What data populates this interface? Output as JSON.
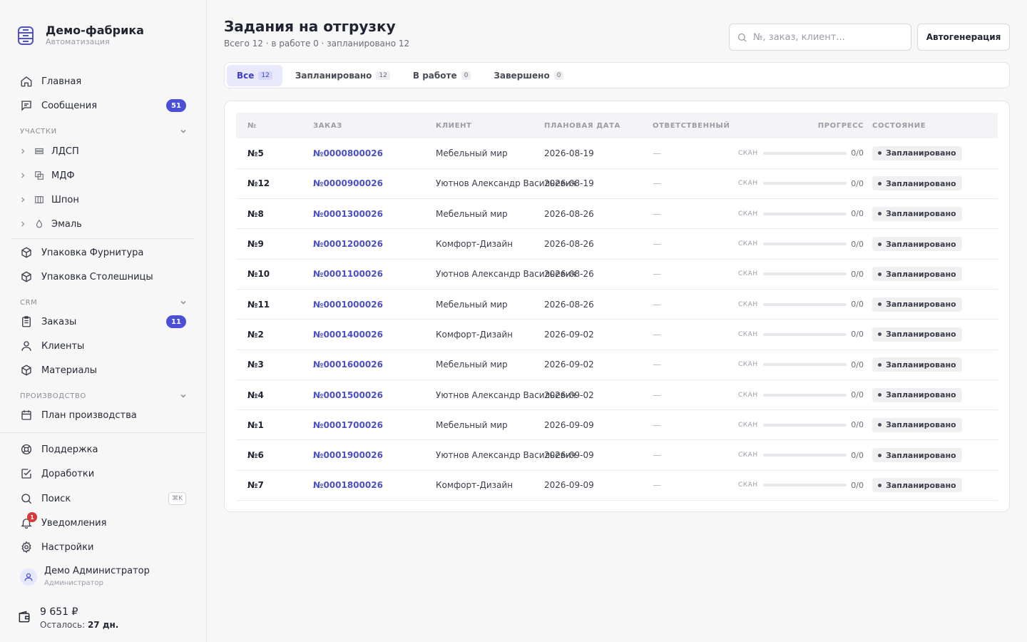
{
  "brand": {
    "title": "Демо-фабрика",
    "subtitle": "Автоматизация"
  },
  "nav": {
    "home": "Главная",
    "messages": "Сообщения",
    "messages_badge": "51",
    "section_sites": "УЧАСТКИ",
    "sites": [
      "ЛДСП",
      "МДФ",
      "Шпон",
      "Эмаль"
    ],
    "pack_furniture": "Упаковка Фурнитура",
    "pack_countertops": "Упаковка Столешницы",
    "section_crm": "CRM",
    "orders": "Заказы",
    "orders_badge": "11",
    "clients": "Клиенты",
    "materials": "Материалы",
    "section_production": "ПРОИЗВОДСТВО",
    "production_plan": "План производства",
    "support": "Поддержка",
    "improvements": "Доработки",
    "search": "Поиск",
    "search_kbd": "⌘K",
    "notifications": "Уведомления",
    "notifications_badge": "1",
    "settings": "Настройки"
  },
  "user": {
    "name": "Демо Администратор",
    "role": "Администратор"
  },
  "wallet": {
    "amount": "9 651 ₽",
    "left_label": "Осталось: ",
    "left_value": "27 дн."
  },
  "page": {
    "title": "Задания на отгрузку",
    "subtitle": "Всего 12 · в работе 0 · запланировано 12",
    "search_placeholder": "№, заказ, клиент...",
    "autogen_button": "Автогенерация"
  },
  "tabs": [
    {
      "label": "Все",
      "count": "12"
    },
    {
      "label": "Запланировано",
      "count": "12"
    },
    {
      "label": "В работе",
      "count": "0"
    },
    {
      "label": "Завершено",
      "count": "0"
    }
  ],
  "table": {
    "headers": [
      "№",
      "ЗАКАЗ",
      "КЛИЕНТ",
      "ПЛАНОВАЯ ДАТА",
      "ОТВЕТСТВЕННЫЙ",
      "ПРОГРЕСС",
      "СОСТОЯНИЕ"
    ],
    "scan_label": "СКАН",
    "rows": [
      {
        "num": "№5",
        "order": "№0000800026",
        "client": "Мебельный мир",
        "date": "2026-08-19",
        "responsible": "—",
        "progress": "0/0",
        "progress_fraction": 0,
        "status": "Запланировано"
      },
      {
        "num": "№12",
        "order": "№0000900026",
        "client": "Уютнов Александр Васильевич",
        "date": "2026-08-19",
        "responsible": "—",
        "progress": "0/0",
        "progress_fraction": 0,
        "status": "Запланировано"
      },
      {
        "num": "№8",
        "order": "№0001300026",
        "client": "Мебельный мир",
        "date": "2026-08-26",
        "responsible": "—",
        "progress": "0/0",
        "progress_fraction": 0,
        "status": "Запланировано"
      },
      {
        "num": "№9",
        "order": "№0001200026",
        "client": "Комфорт-Дизайн",
        "date": "2026-08-26",
        "responsible": "—",
        "progress": "0/0",
        "progress_fraction": 0,
        "status": "Запланировано"
      },
      {
        "num": "№10",
        "order": "№0001100026",
        "client": "Уютнов Александр Васильевич",
        "date": "2026-08-26",
        "responsible": "—",
        "progress": "0/0",
        "progress_fraction": 0,
        "status": "Запланировано"
      },
      {
        "num": "№11",
        "order": "№0001000026",
        "client": "Мебельный мир",
        "date": "2026-08-26",
        "responsible": "—",
        "progress": "0/0",
        "progress_fraction": 0,
        "status": "Запланировано"
      },
      {
        "num": "№2",
        "order": "№0001400026",
        "client": "Комфорт-Дизайн",
        "date": "2026-09-02",
        "responsible": "—",
        "progress": "0/0",
        "progress_fraction": 0,
        "status": "Запланировано"
      },
      {
        "num": "№3",
        "order": "№0001600026",
        "client": "Мебельный мир",
        "date": "2026-09-02",
        "responsible": "—",
        "progress": "0/0",
        "progress_fraction": 0,
        "status": "Запланировано"
      },
      {
        "num": "№4",
        "order": "№0001500026",
        "client": "Уютнов Александр Васильевич",
        "date": "2026-09-02",
        "responsible": "—",
        "progress": "0/0",
        "progress_fraction": 0,
        "status": "Запланировано"
      },
      {
        "num": "№1",
        "order": "№0001700026",
        "client": "Мебельный мир",
        "date": "2026-09-09",
        "responsible": "—",
        "progress": "0/0",
        "progress_fraction": 0,
        "status": "Запланировано"
      },
      {
        "num": "№6",
        "order": "№0001900026",
        "client": "Уютнов Александр Васильевич",
        "date": "2026-09-09",
        "responsible": "—",
        "progress": "0/0",
        "progress_fraction": 0,
        "status": "Запланировано"
      },
      {
        "num": "№7",
        "order": "№0001800026",
        "client": "Комфорт-Дизайн",
        "date": "2026-09-09",
        "responsible": "—",
        "progress": "0/0",
        "progress_fraction": 0,
        "status": "Запланировано"
      }
    ]
  },
  "colors": {
    "accent": "#4b4fd8",
    "notification": "#d9383a"
  }
}
